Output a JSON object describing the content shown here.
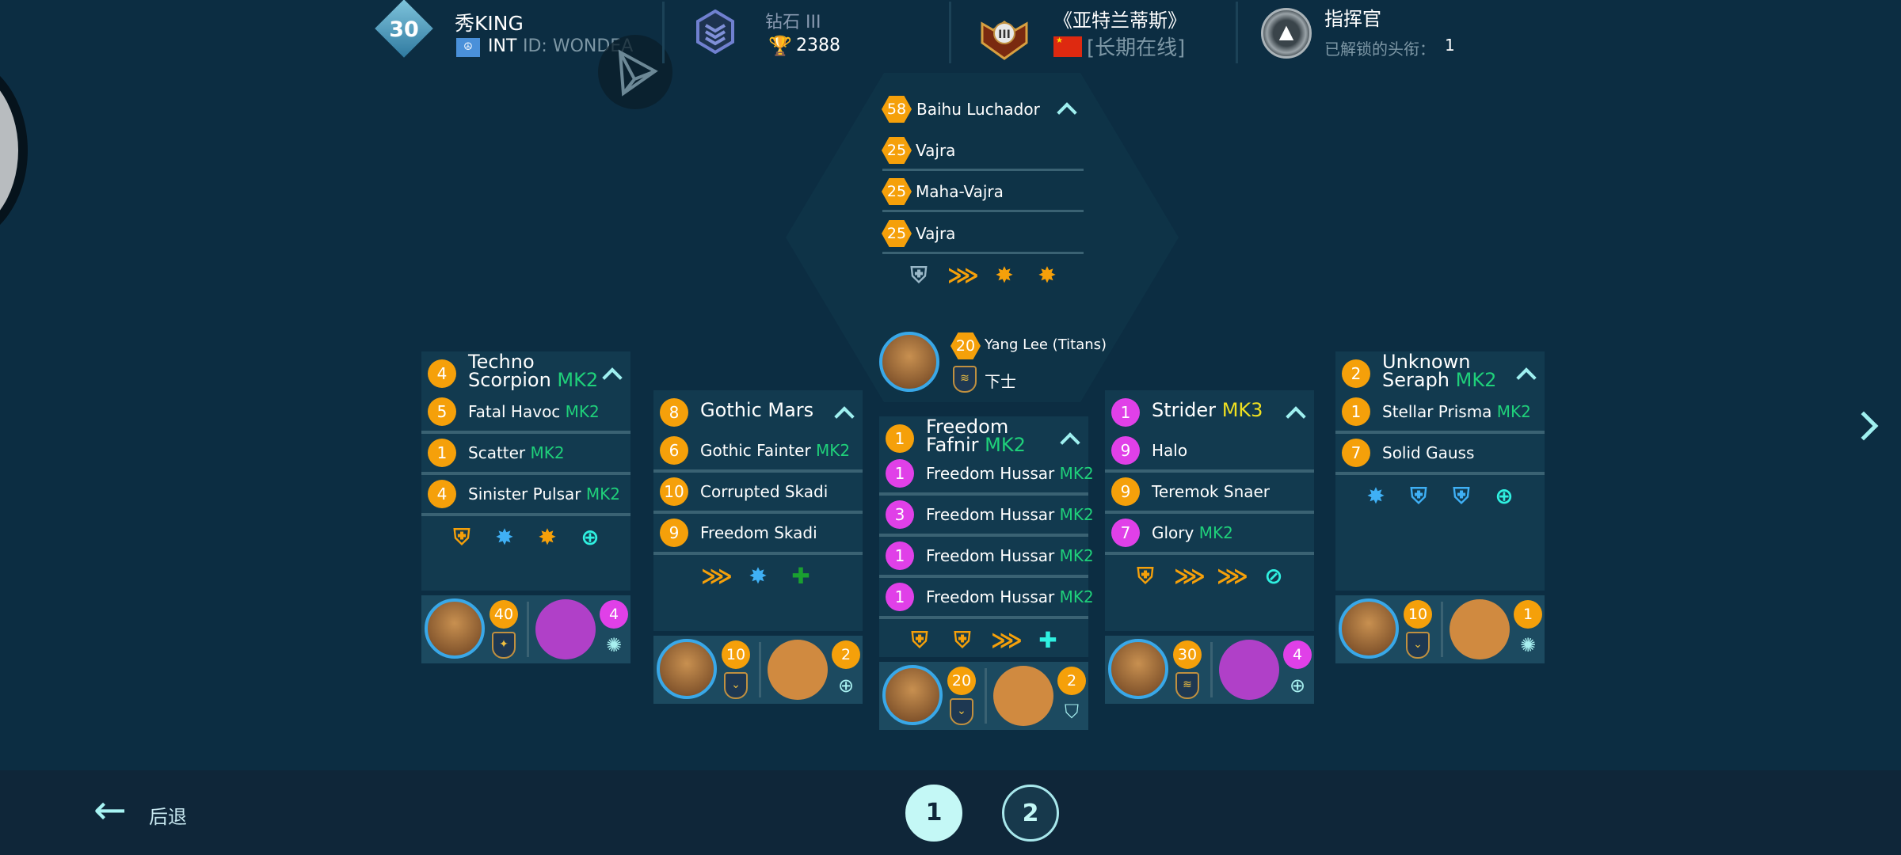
{
  "header": {
    "player": {
      "level": "30",
      "name": "秀KING",
      "region": "INT",
      "id_label": "ID: WONDEA"
    },
    "rank": {
      "name": "钻石 III",
      "trophies": "2388"
    },
    "league": {
      "name": "《亚特兰蒂斯》",
      "status": "[长期在线]"
    },
    "title": {
      "name": "指挥官",
      "unlocked_label": "已解锁的头衔：",
      "unlocked_count": "1"
    }
  },
  "titan": {
    "name": "Baihu Luchador",
    "level": "58",
    "weapons": [
      {
        "level": "25",
        "name": "Vajra"
      },
      {
        "level": "25",
        "name": "Maha-Vajra"
      },
      {
        "level": "25",
        "name": "Vajra"
      }
    ],
    "modules": [
      "shield-up-icon",
      "damage-boost-icon",
      "explosion-boost-icon",
      "explosion-boost-icon"
    ],
    "pilot": {
      "level": "20",
      "name": "Yang Lee (Titans)",
      "rank": "下士"
    }
  },
  "robots": [
    {
      "level": "4",
      "name_line1": "Techno",
      "name_line2": "Scorpion",
      "mk": "MK2",
      "badge_color": "orange",
      "weapons": [
        {
          "level": "5",
          "name": "Fatal Havoc",
          "mk": "MK2",
          "color": "orange"
        },
        {
          "level": "1",
          "name": "Scatter",
          "mk": "MK2",
          "color": "orange"
        },
        {
          "level": "4",
          "name": "Sinister Pulsar",
          "mk": "MK2",
          "color": "orange"
        }
      ],
      "modules": [
        {
          "icon": "repair-boost-icon",
          "glyph": "⛨",
          "color": "orange"
        },
        {
          "icon": "blast-up-icon",
          "glyph": "✸",
          "color": "blue"
        },
        {
          "icon": "blast-melee-icon",
          "glyph": "✸",
          "color": "orange"
        },
        {
          "icon": "target-icon",
          "glyph": "⊕",
          "color": "cyan"
        }
      ],
      "pilot": {
        "level": "40",
        "rank_glyph": "✦"
      },
      "drone": {
        "level": "4",
        "color": "purple",
        "skill": "burst-icon",
        "skill_glyph": "✺"
      }
    },
    {
      "level": "8",
      "name_line1": "Gothic Mars",
      "name_line2": "",
      "mk": "",
      "badge_color": "orange",
      "weapons": [
        {
          "level": "6",
          "name": "Gothic Fainter",
          "mk": "MK2",
          "color": "orange"
        },
        {
          "level": "10",
          "name": "Corrupted Skadi",
          "mk": "",
          "color": "orange"
        },
        {
          "level": "9",
          "name": "Freedom Skadi",
          "mk": "",
          "color": "orange"
        }
      ],
      "modules": [
        {
          "icon": "damage-boost-icon",
          "glyph": "⋙",
          "color": "orange"
        },
        {
          "icon": "blast-up-icon",
          "glyph": "✸",
          "color": "blue"
        },
        {
          "icon": "unknown-boost-icon",
          "glyph": "✚",
          "color": "green"
        }
      ],
      "pilot": {
        "level": "10",
        "rank_glyph": "⌄"
      },
      "drone": {
        "level": "2",
        "color": "orange",
        "skill": "target-burst-icon",
        "skill_glyph": "⊕"
      }
    },
    {
      "level": "1",
      "name_line1": "Freedom",
      "name_line2": "Fafnir",
      "mk": "MK2",
      "badge_color": "orange",
      "weapons": [
        {
          "level": "1",
          "name": "Freedom Hussar",
          "mk": "MK2",
          "color": "purple"
        },
        {
          "level": "3",
          "name": "Freedom Hussar",
          "mk": "MK2",
          "color": "purple"
        },
        {
          "level": "1",
          "name": "Freedom Hussar",
          "mk": "MK2",
          "color": "purple"
        },
        {
          "level": "1",
          "name": "Freedom Hussar",
          "mk": "MK2",
          "color": "purple"
        }
      ],
      "modules": [
        {
          "icon": "repair-boost-icon",
          "glyph": "⛨",
          "color": "orange"
        },
        {
          "icon": "repair-boost-icon",
          "glyph": "⛨",
          "color": "orange"
        },
        {
          "icon": "damage-boost-icon",
          "glyph": "⋙",
          "color": "orange"
        },
        {
          "icon": "heal-plus-icon",
          "glyph": "✚",
          "color": "cyan"
        }
      ],
      "pilot": {
        "level": "20",
        "rank_glyph": "⌄"
      },
      "drone": {
        "level": "2",
        "color": "orange",
        "skill": "armor-up-icon",
        "skill_glyph": "⛉"
      }
    },
    {
      "level": "1",
      "name_line1": "Strider",
      "name_line2": "",
      "mk": "MK3",
      "badge_color": "purple",
      "weapons": [
        {
          "level": "9",
          "name": "Halo",
          "mk": "",
          "color": "purple"
        },
        {
          "level": "9",
          "name": "Teremok Snaer",
          "mk": "",
          "color": "orange"
        },
        {
          "level": "7",
          "name": "Glory",
          "mk": "MK2",
          "color": "purple"
        }
      ],
      "modules": [
        {
          "icon": "repair-boost-icon",
          "glyph": "⛨",
          "color": "orange"
        },
        {
          "icon": "damage-boost-icon",
          "glyph": "⋙",
          "color": "orange"
        },
        {
          "icon": "damage-boost-icon",
          "glyph": "⋙",
          "color": "orange"
        },
        {
          "icon": "no-speed-icon",
          "glyph": "⊘",
          "color": "cyan"
        }
      ],
      "pilot": {
        "level": "30",
        "rank_glyph": "≋"
      },
      "drone": {
        "level": "4",
        "color": "purple",
        "skill": "target-missile-icon",
        "skill_glyph": "⊕"
      }
    },
    {
      "level": "2",
      "name_line1": "Unknown",
      "name_line2": "Seraph",
      "mk": "MK2",
      "badge_color": "orange",
      "weapons": [
        {
          "level": "1",
          "name": "Stellar Prisma",
          "mk": "MK2",
          "color": "orange"
        },
        {
          "level": "7",
          "name": "Solid Gauss",
          "mk": "",
          "color": "orange"
        }
      ],
      "modules": [
        {
          "icon": "blast-up-icon",
          "glyph": "✸",
          "color": "blue"
        },
        {
          "icon": "shield-up-icon",
          "glyph": "⛨",
          "color": "blue"
        },
        {
          "icon": "shield-up-icon",
          "glyph": "⛨",
          "color": "blue"
        },
        {
          "icon": "target-icon",
          "glyph": "⊕",
          "color": "cyan"
        }
      ],
      "pilot": {
        "level": "10",
        "rank_glyph": "⌄"
      },
      "drone": {
        "level": "1",
        "color": "orange",
        "skill": "stealth-burst-icon",
        "skill_glyph": "✺"
      }
    }
  ],
  "footer": {
    "back_label": "后退",
    "pages": [
      "1",
      "2"
    ],
    "active_page": "1"
  }
}
